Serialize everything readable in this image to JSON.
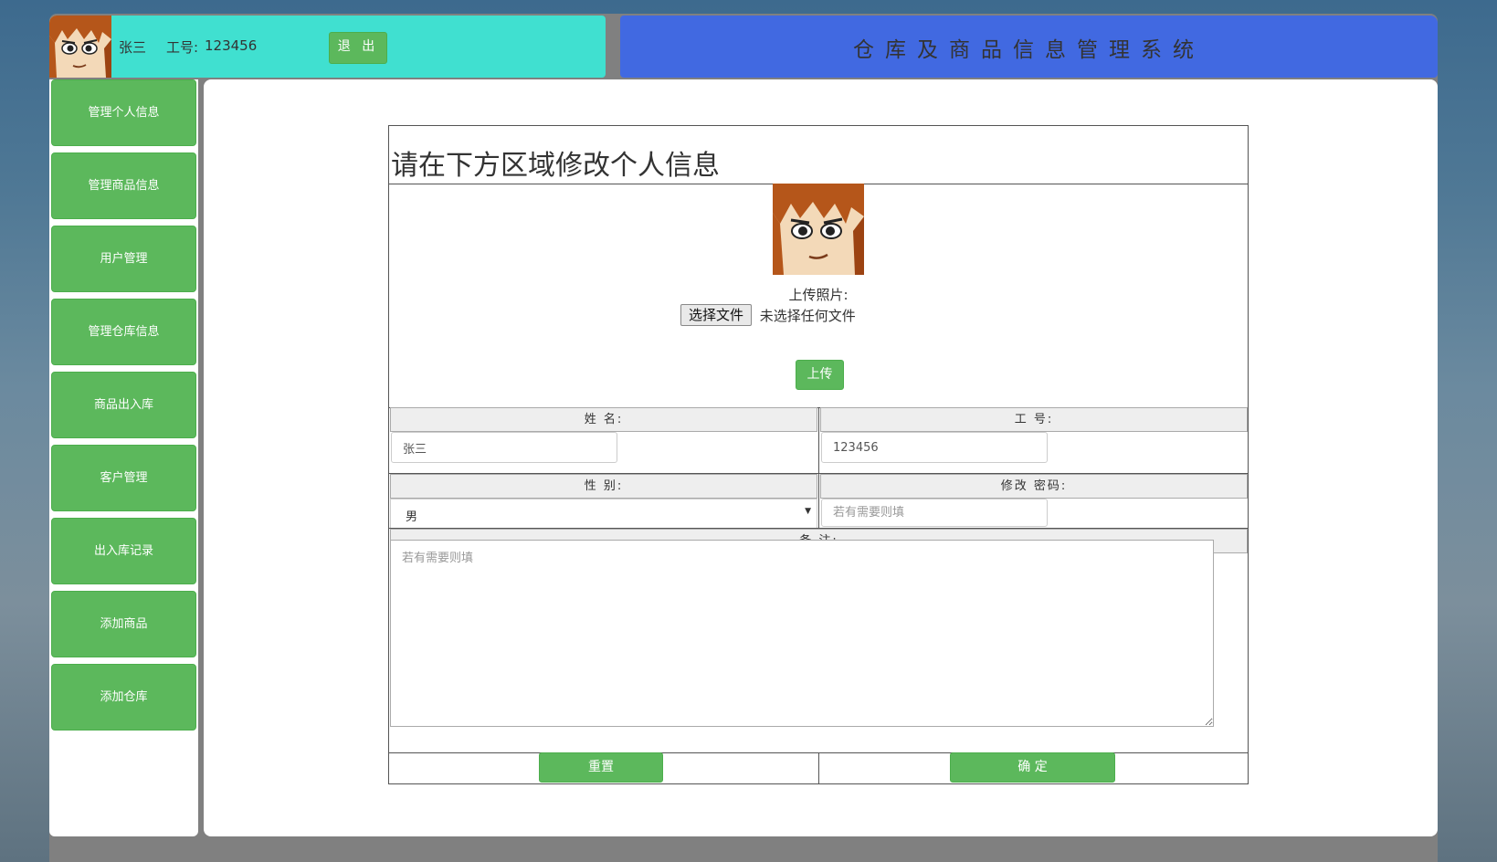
{
  "user": {
    "name": "张三",
    "id_label": "工号:",
    "id_value": "123456",
    "logout_label": "退 出"
  },
  "app": {
    "title": "仓库及商品信息管理系统"
  },
  "sidebar": {
    "items": [
      {
        "label": "管理个人信息"
      },
      {
        "label": "管理商品信息"
      },
      {
        "label": "用户管理"
      },
      {
        "label": "管理仓库信息"
      },
      {
        "label": "商品出入库"
      },
      {
        "label": "客户管理"
      },
      {
        "label": "出入库记录"
      },
      {
        "label": "添加商品"
      },
      {
        "label": "添加仓库"
      }
    ]
  },
  "form": {
    "heading": "请在下方区域修改个人信息",
    "upload_label": "上传照片:",
    "choose_file_label": "选择文件",
    "file_status": "未选择任何文件",
    "upload_button": "上传",
    "name_label": "姓 名:",
    "name_value": "张三",
    "id_label": "工 号:",
    "id_value": "123456",
    "gender_label": "性 别:",
    "gender_value": "男",
    "password_label": "修改 密码:",
    "password_placeholder": "若有需要则填",
    "remark_label": "备 注:",
    "remark_placeholder": "若有需要则填",
    "reset_button": "重置",
    "confirm_button": "确 定"
  },
  "colors": {
    "userbar_bg": "#40e0d0",
    "titlebar_bg": "#4169e1",
    "button_green": "#5cb85c"
  }
}
